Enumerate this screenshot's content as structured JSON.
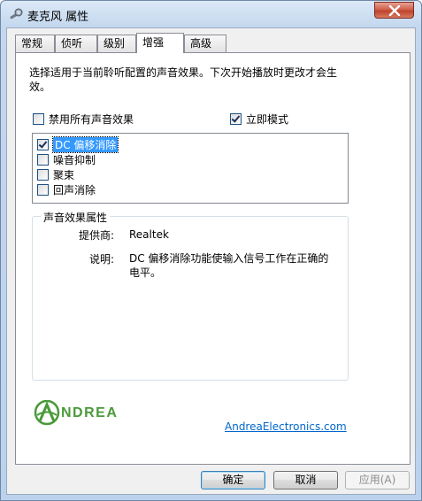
{
  "window": {
    "title": "麦克风 属性"
  },
  "tabs": [
    {
      "label": "常规"
    },
    {
      "label": "侦听"
    },
    {
      "label": "级别"
    },
    {
      "label": "增强"
    },
    {
      "label": "高级"
    }
  ],
  "panel": {
    "description": "选择适用于当前聆听配置的声音效果。下次开始播放时更改才会生效。",
    "disable_all": {
      "label": "禁用所有声音效果",
      "checked": false
    },
    "immediate_mode": {
      "label": "立即模式",
      "checked": true
    },
    "effects": [
      {
        "label": "DC 偏移消除",
        "checked": true,
        "selected": true
      },
      {
        "label": "噪音抑制",
        "checked": false
      },
      {
        "label": "聚束",
        "checked": false
      },
      {
        "label": "回声消除",
        "checked": false
      }
    ],
    "properties": {
      "group_title": "声音效果属性",
      "provider_label": "提供商:",
      "provider_value": "Realtek",
      "description_label": "说明:",
      "description_value": "DC 偏移消除功能使输入信号工作在正确的电平。"
    },
    "logo_text": "NDREA",
    "link_text": "AndreaElectronics.com"
  },
  "buttons": {
    "ok": "确定",
    "cancel": "取消",
    "apply": "应用(A)"
  },
  "colors": {
    "logo_green": "#4a9a3a",
    "link_blue": "#0066cc",
    "selection": "#3399ff"
  }
}
